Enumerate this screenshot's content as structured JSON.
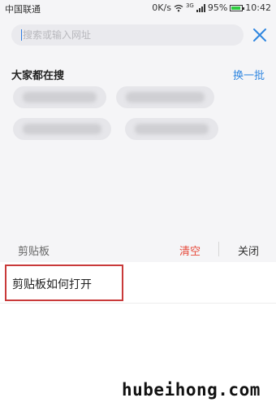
{
  "status_bar": {
    "carrier": "中国联通",
    "speed": "0K/s",
    "network": "3G",
    "battery": "95%",
    "time": "10:42"
  },
  "search": {
    "placeholder": "搜索或输入网址",
    "value": ""
  },
  "trending": {
    "title": "大家都在搜",
    "refresh_label": "换一批"
  },
  "clipboard": {
    "label": "剪贴板",
    "clear_label": "清空",
    "close_label": "关闭",
    "items": [
      "剪贴板如何打开"
    ]
  },
  "watermark": "hubeihong.com",
  "colors": {
    "accent": "#2f86e0",
    "danger": "#e64a3b",
    "highlight_border": "#c93a3a"
  }
}
